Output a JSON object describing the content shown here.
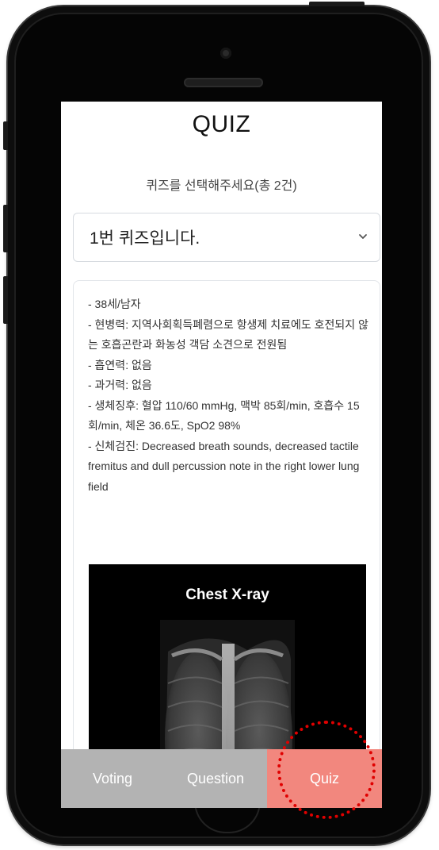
{
  "header": {
    "title": "QUIZ",
    "subtitle": "퀴즈를 선택해주세요(총 2건)"
  },
  "quiz_select": {
    "selected": "1번 퀴즈입니다."
  },
  "case_info": {
    "lines": [
      "- 38세/남자",
      "- 현병력: 지역사회획득폐렴으로 항생제 치료에도 호전되지 않는 호흡곤란과 화농성 객담 소견으로 전원됨",
      "- 흡연력: 없음",
      "- 과거력: 없음",
      "- 생체징후: 혈압 110/60 mmHg, 맥박 85회/min, 호흡수 15회/min, 체온 36.6도, SpO2 98%",
      "- 신체검진: Decreased breath sounds, decreased tactile fremitus and dull percussion note in the right lower lung field"
    ],
    "image_title": "Chest X-ray"
  },
  "tabs": [
    {
      "label": "Voting"
    },
    {
      "label": "Question"
    },
    {
      "label": "Quiz"
    }
  ],
  "colors": {
    "tab_inactive": "#b3b3b3",
    "tab_active": "#f2877e",
    "annotation": "#e00000"
  }
}
